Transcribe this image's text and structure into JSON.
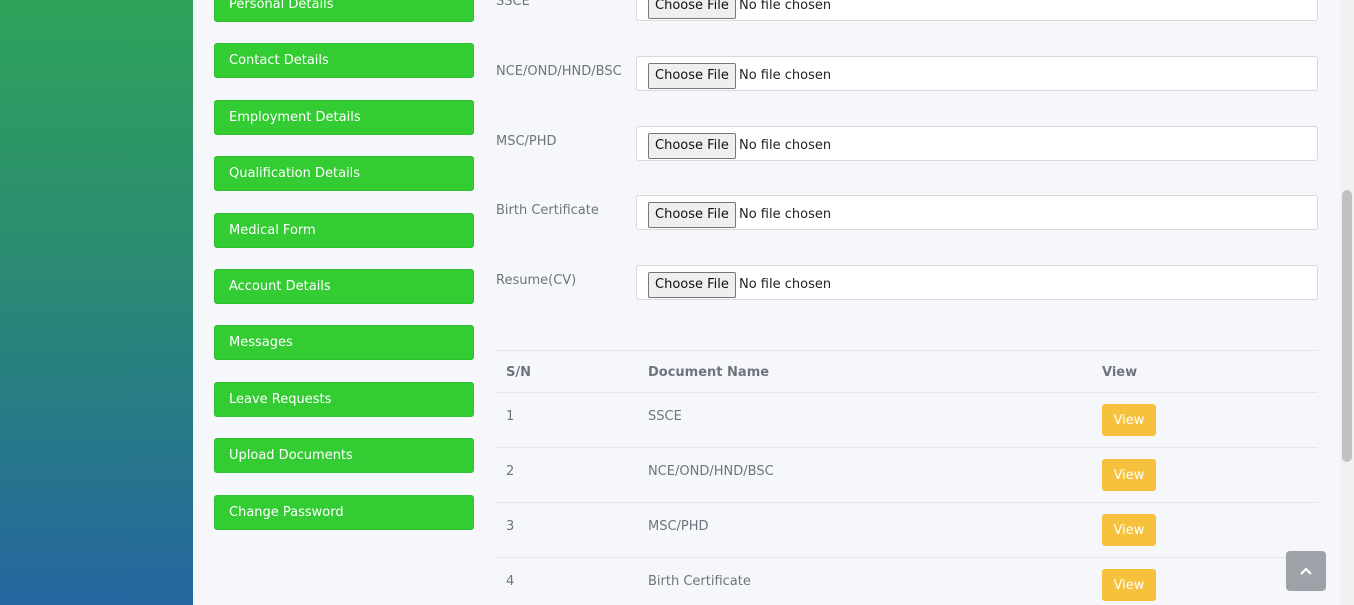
{
  "sidebar_menu": [
    {
      "label": "Personal Details"
    },
    {
      "label": "Contact Details"
    },
    {
      "label": "Employment Details"
    },
    {
      "label": "Qualification Details"
    },
    {
      "label": "Medical Form"
    },
    {
      "label": "Account Details"
    },
    {
      "label": "Messages"
    },
    {
      "label": "Leave Requests"
    },
    {
      "label": "Upload Documents"
    },
    {
      "label": "Change Password"
    }
  ],
  "upload_fields": [
    {
      "label": "SSCE",
      "button": "Choose File",
      "status": "No file chosen"
    },
    {
      "label": "NCE/OND/HND/BSC",
      "button": "Choose File",
      "status": "No file chosen"
    },
    {
      "label": "MSC/PHD",
      "button": "Choose File",
      "status": "No file chosen"
    },
    {
      "label": "Birth Certificate",
      "button": "Choose File",
      "status": "No file chosen"
    },
    {
      "label": "Resume(CV)",
      "button": "Choose File",
      "status": "No file chosen"
    }
  ],
  "documents_table": {
    "headers": [
      "S/N",
      "Document Name",
      "View"
    ],
    "rows": [
      {
        "sn": "1",
        "name": "SSCE",
        "action": "View"
      },
      {
        "sn": "2",
        "name": "NCE/OND/HND/BSC",
        "action": "View"
      },
      {
        "sn": "3",
        "name": "MSC/PHD",
        "action": "View"
      },
      {
        "sn": "4",
        "name": "Birth Certificate",
        "action": "View"
      }
    ]
  },
  "icons": {
    "scroll_top": "chevron-up-icon"
  },
  "colors": {
    "menu_button": "#33cc33",
    "view_button": "#f6c23e",
    "page_background": "#f6f7fb"
  }
}
